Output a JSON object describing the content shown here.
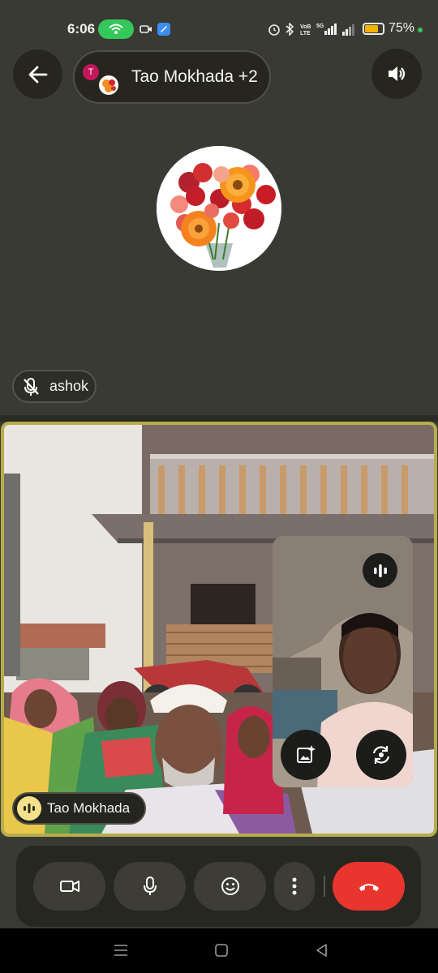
{
  "status_bar": {
    "time": "6:06",
    "battery_percent": "75%",
    "battery_level": 0.75,
    "icons": [
      "hotspot-icon",
      "video-icon",
      "app-icon",
      "alarm-icon",
      "bluetooth-icon",
      "volte-icon",
      "signal-5g-icon",
      "signal-icon",
      "battery-icon"
    ],
    "colors": {
      "hotspot": "#34c759",
      "battery_fill": "#f4b400"
    }
  },
  "header": {
    "back_icon": "arrow-back-icon",
    "group_name": "Tao Mokhada +2",
    "group_avatar_initial": "T",
    "speaker_icon": "speaker-icon"
  },
  "top_tile": {
    "participant_name": "ashok",
    "mic_state_icon": "mic-off-icon",
    "avatar": "flowers-avatar"
  },
  "video_tile": {
    "participant_name": "Tao Mokhada",
    "speaking_icon": "audio-waves-icon",
    "border_color": "#b8ad4c",
    "self_view_buttons": [
      "audio-waves-icon",
      "add-effect-icon",
      "switch-camera-icon"
    ]
  },
  "controls": {
    "items": [
      "camera-icon",
      "mic-icon",
      "emoji-icon",
      "more-vert-icon",
      "end-call-icon"
    ],
    "end_call_color": "#e8352d"
  },
  "nav_bar": {
    "items": [
      "menu-icon",
      "home-icon",
      "back-icon"
    ]
  }
}
